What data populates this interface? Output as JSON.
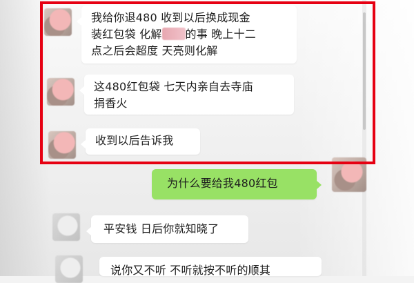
{
  "chat": {
    "messages": [
      {
        "sender": "other",
        "lines": [
          "我给你退480 收到以后换成现金",
          "装红包袋 化解",
          "的事 晚上十二",
          "点之后会超度 天亮则化解"
        ]
      },
      {
        "sender": "other",
        "lines": [
          "这480红包袋 七天内亲自去寺庙",
          "捐香火"
        ]
      },
      {
        "sender": "other",
        "lines": [
          "收到以后告诉我"
        ]
      },
      {
        "sender": "self",
        "lines": [
          "为什么要给我480红包"
        ]
      },
      {
        "sender": "other",
        "lines": [
          "平安钱 日后你就知晓了"
        ]
      },
      {
        "sender": "other",
        "lines": [
          "说你又不听 不听就按不听的顺其"
        ]
      }
    ]
  },
  "icons": {
    "avatar": "blurred-avatar-icon",
    "self_avatar": "blurred-self-avatar-icon",
    "redaction": "redaction-mark"
  },
  "colors": {
    "highlight_border": "#e60012",
    "incoming_bubble": "#ffffff",
    "outgoing_bubble": "#98e165"
  }
}
